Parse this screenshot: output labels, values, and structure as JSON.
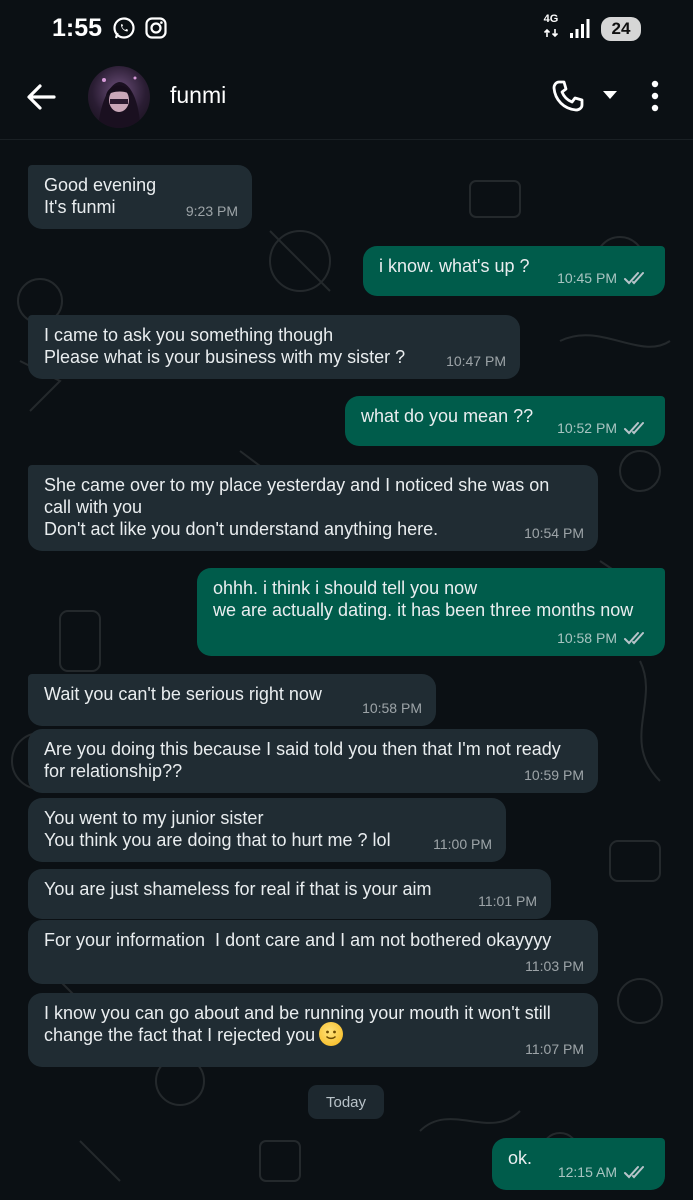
{
  "status_bar": {
    "time": "1:55",
    "network": "4G",
    "battery": "24",
    "app_icons": [
      "whatsapp-icon",
      "instagram-icon"
    ]
  },
  "header": {
    "contact_name": "funmi"
  },
  "colors": {
    "incoming_bubble": "#202c33",
    "outgoing_bubble": "#005c4b",
    "background": "#0b1014",
    "read_ticks": "#9aa5ab"
  },
  "messages": [
    {
      "direction": "in",
      "text": "Good evening\nIt's funmi",
      "time": "9:23 PM"
    },
    {
      "direction": "out",
      "text": "i know. what's up ?",
      "time": "10:45 PM",
      "status": "read"
    },
    {
      "direction": "in",
      "text": "I came to ask you something though\nPlease what is your business with my sister ?",
      "time": "10:47 PM"
    },
    {
      "direction": "out",
      "text": "what do you mean ??",
      "time": "10:52 PM",
      "status": "read"
    },
    {
      "direction": "in",
      "text": "She came over to my place yesterday and I noticed she was on\ncall with you\nDon't act like you don't understand anything here.",
      "time": "10:54 PM"
    },
    {
      "direction": "out",
      "text": "ohhh. i think i should tell you now\nwe are actually dating. it has been three months now",
      "time": "10:58 PM",
      "status": "read"
    },
    {
      "direction": "in",
      "text": "Wait you can't be serious right now",
      "time": "10:58 PM"
    },
    {
      "direction": "in",
      "text": "Are you doing this because I said told you then that I'm not ready\nfor relationship??",
      "time": "10:59 PM"
    },
    {
      "direction": "in",
      "text": "You went to my junior sister\nYou think you are doing that to hurt me ? lol",
      "time": "11:00 PM"
    },
    {
      "direction": "in",
      "text": "You are just shameless for real if that is your aim",
      "time": "11:01 PM"
    },
    {
      "direction": "in",
      "text": "For your information  I dont care and I am not bothered okayyyy",
      "time": "11:03 PM"
    },
    {
      "direction": "in",
      "text": "I know you can go about and be running your mouth it won't still\nchange the fact that I rejected you",
      "time": "11:07 PM",
      "emoji": "slightly-smiling-face-emoji"
    },
    {
      "direction": "out",
      "text": "ok.",
      "time": "12:15 AM",
      "status": "read"
    }
  ],
  "day_divider": "Today"
}
